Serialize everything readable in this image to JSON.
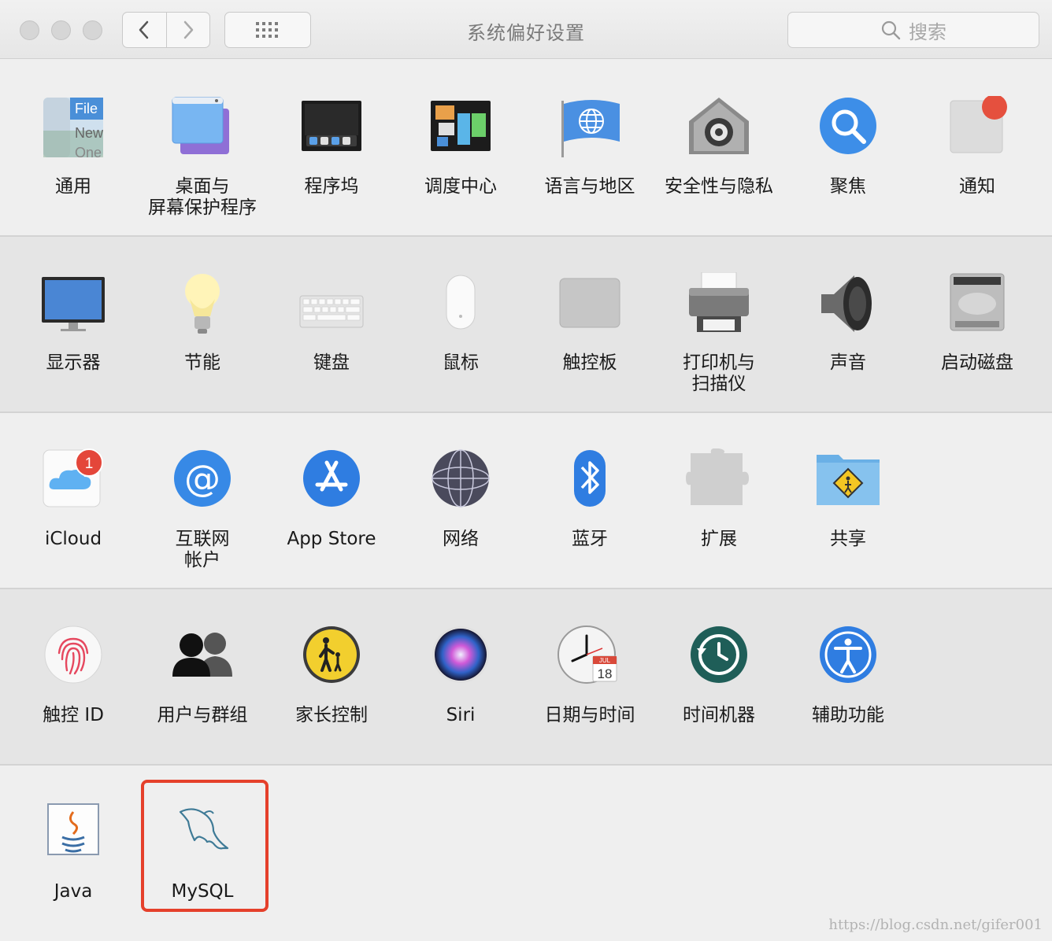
{
  "window": {
    "title": "系统偏好设置",
    "search_placeholder": "搜索",
    "traffic_lights": [
      "close",
      "minimize",
      "zoom"
    ],
    "nav": {
      "back_icon": "chevron-left-icon",
      "forward_icon": "chevron-right-icon",
      "grid_icon": "grid-dots-icon"
    }
  },
  "sections": [
    {
      "items": [
        {
          "id": "general",
          "label": "通用",
          "icon": "general-icon"
        },
        {
          "id": "desktop",
          "label": "桌面与\n屏幕保护程序",
          "icon": "desktop-screensaver-icon"
        },
        {
          "id": "dock",
          "label": "程序坞",
          "icon": "dock-icon"
        },
        {
          "id": "mission",
          "label": "调度中心",
          "icon": "mission-control-icon"
        },
        {
          "id": "language",
          "label": "语言与地区",
          "icon": "language-region-icon"
        },
        {
          "id": "security",
          "label": "安全性与隐私",
          "icon": "security-privacy-icon"
        },
        {
          "id": "spotlight",
          "label": "聚焦",
          "icon": "spotlight-icon"
        },
        {
          "id": "notifications",
          "label": "通知",
          "icon": "notifications-icon"
        }
      ]
    },
    {
      "items": [
        {
          "id": "displays",
          "label": "显示器",
          "icon": "displays-icon"
        },
        {
          "id": "energy",
          "label": "节能",
          "icon": "energy-saver-icon"
        },
        {
          "id": "keyboard",
          "label": "键盘",
          "icon": "keyboard-icon"
        },
        {
          "id": "mouse",
          "label": "鼠标",
          "icon": "mouse-icon"
        },
        {
          "id": "trackpad",
          "label": "触控板",
          "icon": "trackpad-icon"
        },
        {
          "id": "printers",
          "label": "打印机与\n扫描仪",
          "icon": "printer-scanner-icon"
        },
        {
          "id": "sound",
          "label": "声音",
          "icon": "sound-icon"
        },
        {
          "id": "startup",
          "label": "启动磁盘",
          "icon": "startup-disk-icon"
        }
      ]
    },
    {
      "items": [
        {
          "id": "icloud",
          "label": "iCloud",
          "icon": "icloud-icon",
          "badge": "1"
        },
        {
          "id": "internet",
          "label": "互联网\n帐户",
          "icon": "internet-accounts-icon"
        },
        {
          "id": "appstore",
          "label": "App Store",
          "icon": "app-store-icon"
        },
        {
          "id": "network",
          "label": "网络",
          "icon": "network-icon"
        },
        {
          "id": "bluetooth",
          "label": "蓝牙",
          "icon": "bluetooth-icon"
        },
        {
          "id": "extensions",
          "label": "扩展",
          "icon": "extensions-icon"
        },
        {
          "id": "sharing",
          "label": "共享",
          "icon": "sharing-icon"
        }
      ]
    },
    {
      "items": [
        {
          "id": "touchid",
          "label": "触控 ID",
          "icon": "touch-id-icon"
        },
        {
          "id": "users",
          "label": "用户与群组",
          "icon": "users-groups-icon"
        },
        {
          "id": "parental",
          "label": "家长控制",
          "icon": "parental-controls-icon"
        },
        {
          "id": "siri",
          "label": "Siri",
          "icon": "siri-icon"
        },
        {
          "id": "datetime",
          "label": "日期与时间",
          "icon": "date-time-icon",
          "calendar_month": "JUL",
          "calendar_day": "18"
        },
        {
          "id": "timemachine",
          "label": "时间机器",
          "icon": "time-machine-icon"
        },
        {
          "id": "accessibility",
          "label": "辅助功能",
          "icon": "accessibility-icon"
        }
      ]
    },
    {
      "items": [
        {
          "id": "java",
          "label": "Java",
          "icon": "java-icon"
        },
        {
          "id": "mysql",
          "label": "MySQL",
          "icon": "mysql-dolphin-icon",
          "highlighted": true
        }
      ]
    }
  ],
  "general_icon_text": {
    "line1": "File",
    "line2": "New",
    "line3": "One"
  },
  "watermark": "https://blog.csdn.net/gifer001",
  "colors": {
    "highlight": "#e5402b",
    "accent_blue": "#2f7de1"
  }
}
